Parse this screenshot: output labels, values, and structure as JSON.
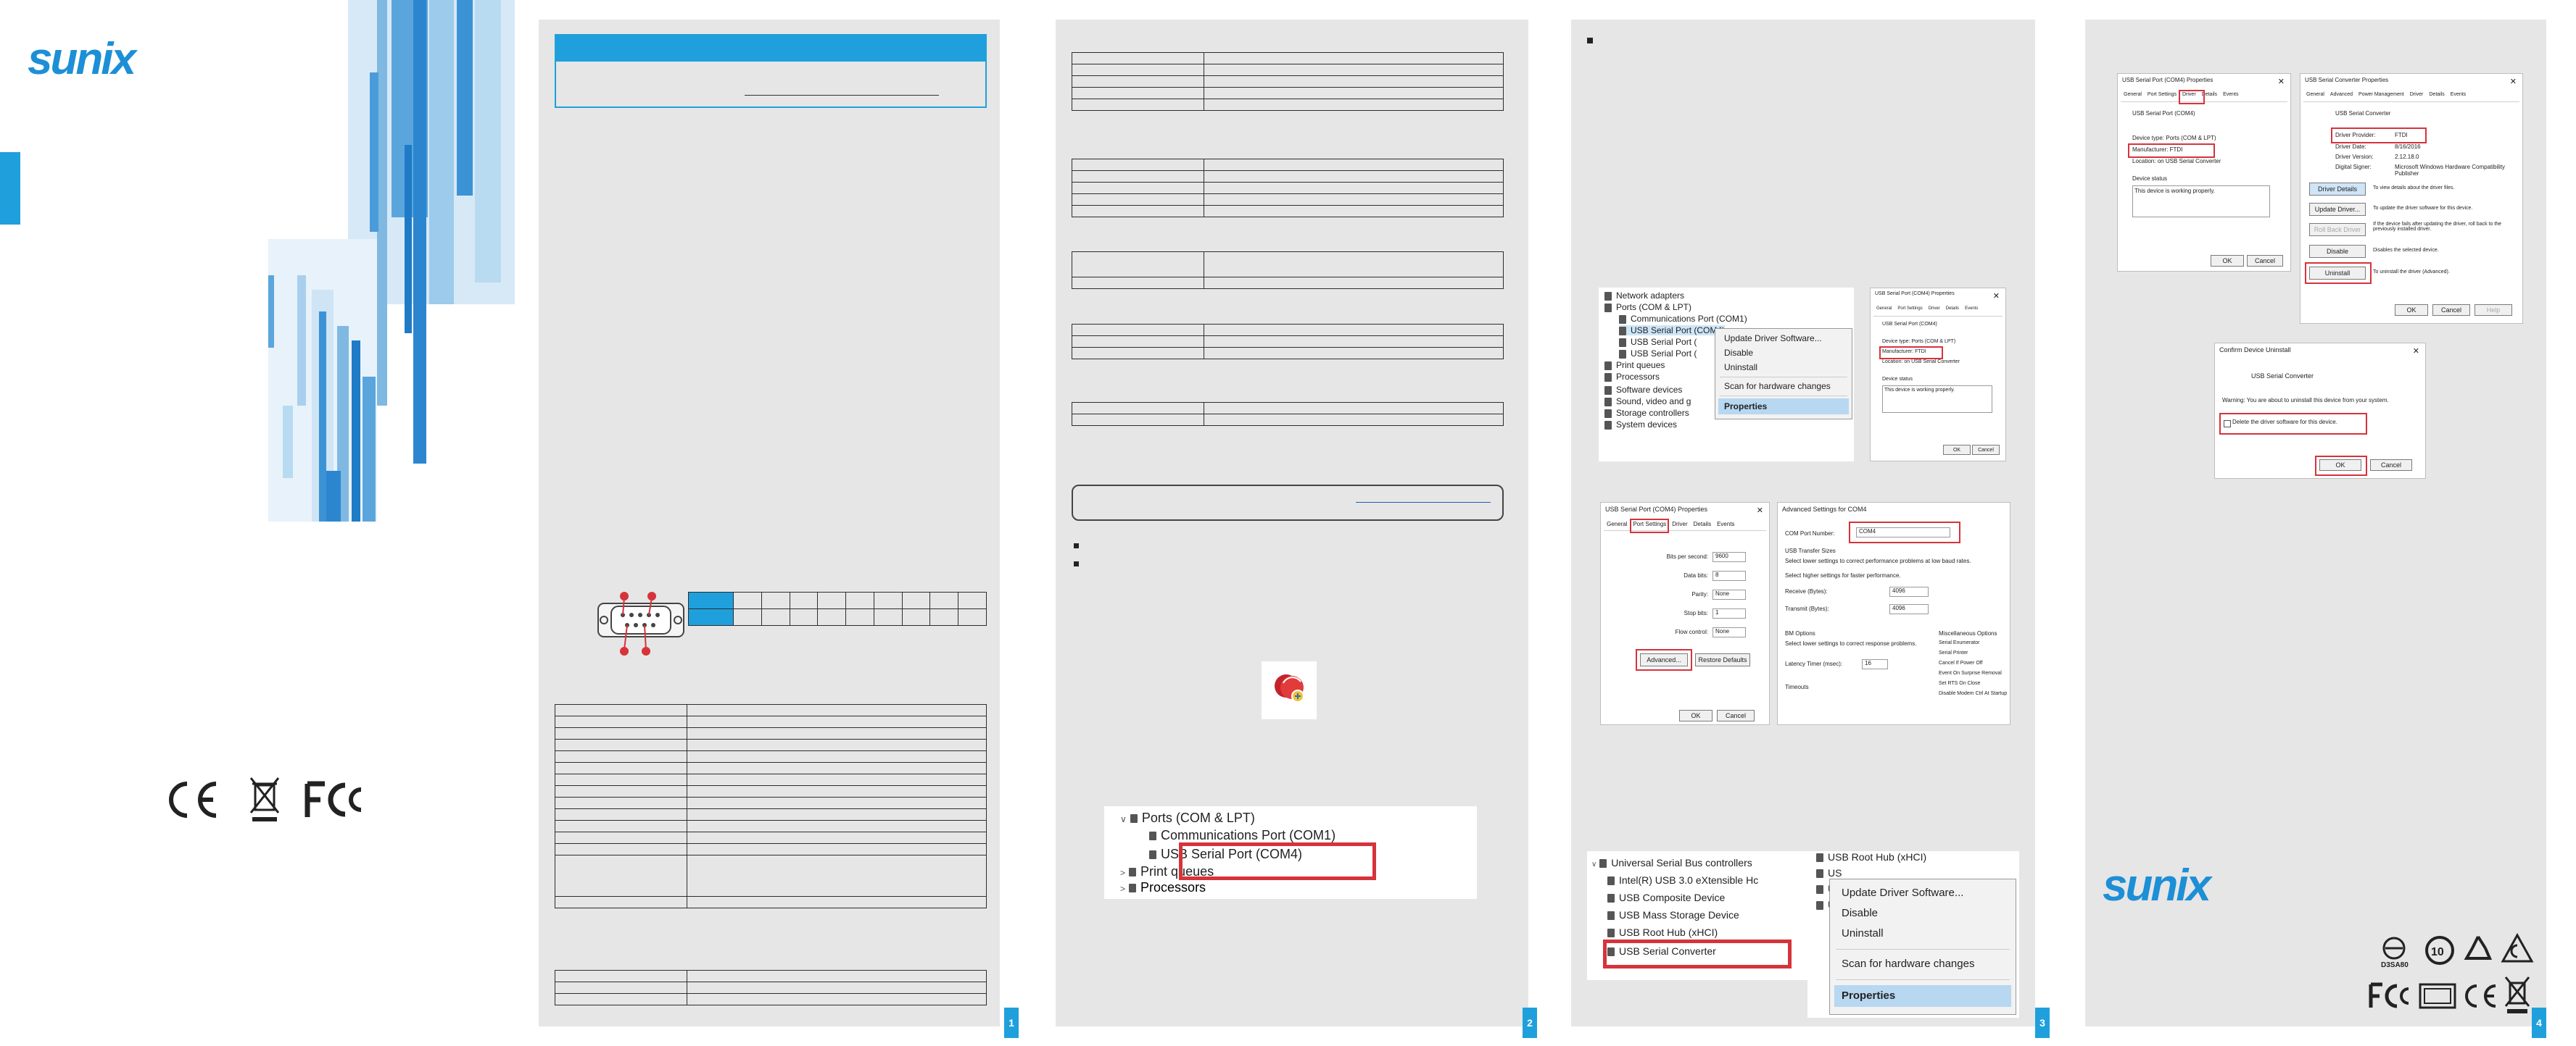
{
  "brand": {
    "logo_text": "sunix"
  },
  "panels": {
    "p1": {
      "page_number": "1"
    },
    "p2": {
      "page_number": "2"
    },
    "p3": {
      "page_number": "3"
    },
    "p4": {
      "page_number": "4"
    }
  },
  "cover": {
    "cert_icons": [
      "ce-mark-icon",
      "weee-bin-icon",
      "fcc-mark-icon"
    ]
  },
  "menu": {
    "update": "Update Driver Software...",
    "disable": "Disable",
    "uninstall": "Uninstall",
    "scan": "Scan for hardware changes",
    "properties": "Properties"
  },
  "device_manager_top": {
    "items": [
      "Network adapters",
      "Ports (COM & LPT)",
      "Communications Port (COM1)",
      "USB Serial Port (COM4)",
      "USB Serial Port (",
      "USB Serial Port (",
      "Print queues",
      "Processors",
      "Software devices",
      "Sound, video and g",
      "Storage controllers",
      "System devices"
    ]
  },
  "device_manager_bottom": {
    "items": [
      "Universal Serial Bus controllers",
      "Intel(R) USB 3.0 eXtensible Hc",
      "USB Composite Device",
      "USB Mass Storage Device",
      "USB Root Hub (xHCI)",
      "USB Serial Converter"
    ],
    "right_items": [
      "USB Root Hub (xHCI)",
      "US",
      "US",
      "US"
    ]
  },
  "device_manager_large": {
    "items": [
      "Ports (COM & LPT)",
      "Communications Port (COM1)",
      "USB Serial Port (COM4)",
      "Print queues",
      "Processors"
    ]
  },
  "dialogs": {
    "com4_props": {
      "title": "USB Serial Port (COM4) Properties",
      "tabs": [
        "General",
        "Port Settings",
        "Driver",
        "Details",
        "Events"
      ],
      "device": "USB Serial Port (COM4)",
      "fields": [
        {
          "label": "Device type:",
          "value": "Ports (COM & LPT)"
        },
        {
          "label": "Manufacturer:",
          "value": "FTDI"
        },
        {
          "label": "Location:",
          "value": "on USB Serial Converter"
        }
      ],
      "status_label": "Device status",
      "status_text": "This device is working properly.",
      "ok": "OK",
      "cancel": "Cancel"
    },
    "port_settings": {
      "title": "USB Serial Port (COM4) Properties",
      "rows": [
        {
          "label": "Bits per second:",
          "value": "9600"
        },
        {
          "label": "Data bits:",
          "value": "8"
        },
        {
          "label": "Parity:",
          "value": "None"
        },
        {
          "label": "Stop bits:",
          "value": "1"
        },
        {
          "label": "Flow control:",
          "value": "None"
        }
      ],
      "advanced": "Advanced...",
      "restore": "Restore Defaults",
      "ok": "OK",
      "cancel": "Cancel"
    },
    "advanced": {
      "title": "Advanced Settings for COM4",
      "com_label": "COM Port Number:",
      "com_value": "COM4",
      "usb_sizes": "USB Transfer Sizes",
      "usb_sizes_hint": "Select lower settings to correct performance problems at low baud rates.",
      "usb_sizes_hint2": "Select higher settings for faster performance.",
      "receive_label": "Receive (Bytes):",
      "receive_value": "4096",
      "transmit_label": "Transmit (Bytes):",
      "transmit_value": "4096",
      "bm_options": "BM Options",
      "bm_hint": "Select lower settings to correct response problems.",
      "latency_label": "Latency Timer (msec):",
      "latency_value": "16",
      "timeouts": "Timeouts",
      "misc_title": "Miscellaneous Options",
      "misc": [
        "Serial Enumerator",
        "Serial Printer",
        "Cancel If Power Off",
        "Event On Surprise Removal",
        "Set RTS On Close",
        "Disable Modem Ctrl At Startup"
      ]
    },
    "driver_tab": {
      "title": "USB Serial Port (COM4) Properties",
      "tabs": [
        "General",
        "Port Settings",
        "Driver",
        "Details",
        "Events"
      ],
      "device": "USB Serial Port (COM4)",
      "fields": [
        {
          "label": "Device type:",
          "value": "Ports (COM & LPT)"
        },
        {
          "label": "Manufacturer:",
          "value": "FTDI"
        },
        {
          "label": "Location:",
          "value": "on USB Serial Converter"
        }
      ],
      "status_label": "Device status",
      "status_text": "This device is working properly.",
      "ok": "OK",
      "cancel": "Cancel"
    },
    "converter": {
      "title": "USB Serial Converter Properties",
      "tabs": [
        "General",
        "Advanced",
        "Power Management",
        "Driver",
        "Details",
        "Events"
      ],
      "device": "USB Serial Converter",
      "fields": [
        {
          "label": "Driver Provider:",
          "value": "FTDI"
        },
        {
          "label": "Driver Date:",
          "value": "8/16/2016"
        },
        {
          "label": "Driver Version:",
          "value": "2.12.18.0"
        },
        {
          "label": "Digital Signer:",
          "value": "Microsoft Windows Hardware Compatibility Publisher"
        }
      ],
      "buttons": [
        {
          "label": "Driver Details",
          "desc": "To view details about the driver files."
        },
        {
          "label": "Update Driver...",
          "desc": "To update the driver software for this device."
        },
        {
          "label": "Roll Back Driver",
          "desc": "If the device fails after updating the driver, roll back to the previously installed driver."
        },
        {
          "label": "Disable",
          "desc": "Disables the selected device."
        },
        {
          "label": "Uninstall",
          "desc": "To uninstall the driver (Advanced)."
        }
      ],
      "ok": "OK",
      "cancel": "Cancel",
      "help": "Help"
    },
    "confirm": {
      "title": "Confirm Device Uninstall",
      "device": "USB Serial Converter",
      "warning": "Warning: You are about to uninstall this device from your system.",
      "checkbox": "Delete the driver software for this device.",
      "ok": "OK",
      "cancel": "Cancel"
    }
  },
  "back": {
    "symbols": [
      "d3sa80-icon",
      "10-year-icon",
      "recycle-icon",
      "ce-triangle-icon",
      "fcc-icon",
      "vcci-icon",
      "ce-icon",
      "weee-icon"
    ],
    "d3sa80": "D3SA80",
    "ten": "10"
  }
}
